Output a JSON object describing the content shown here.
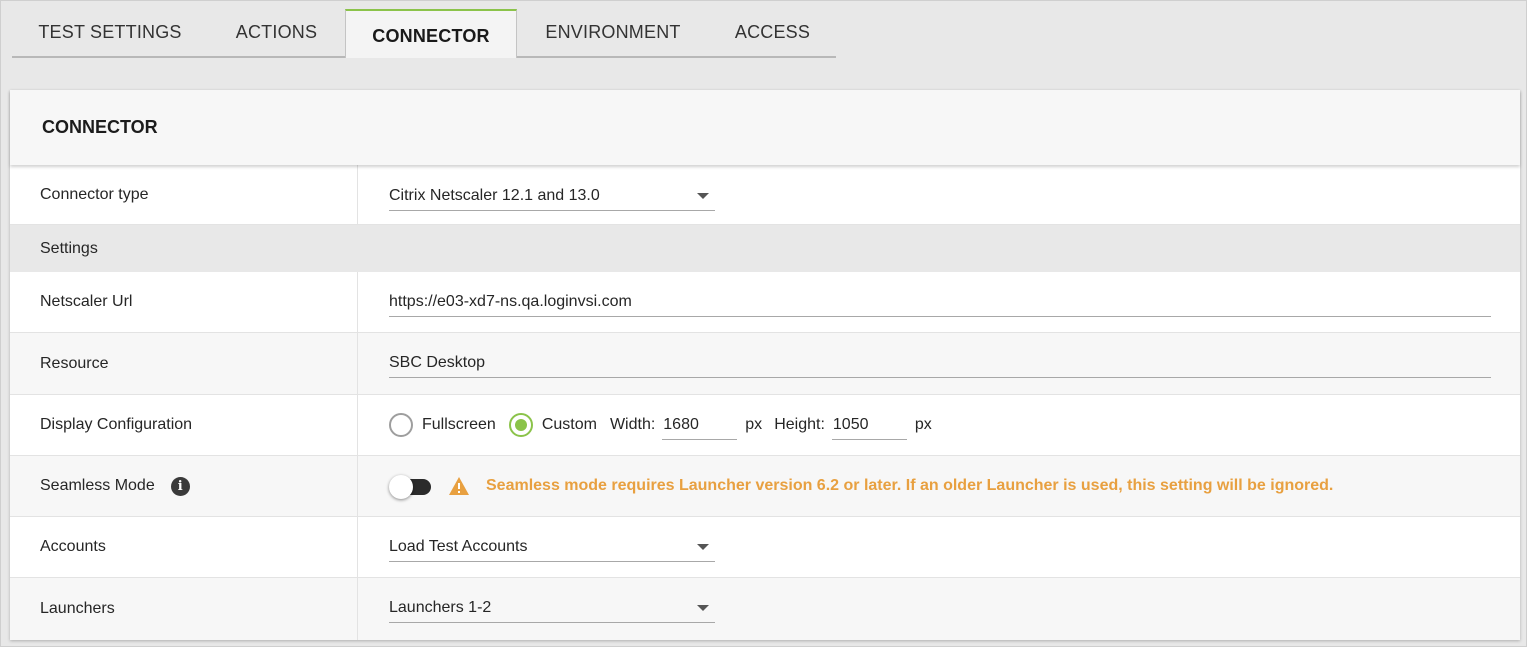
{
  "tabs": [
    {
      "label": "TEST SETTINGS",
      "active": false
    },
    {
      "label": "ACTIONS",
      "active": false
    },
    {
      "label": "CONNECTOR",
      "active": true
    },
    {
      "label": "ENVIRONMENT",
      "active": false
    },
    {
      "label": "ACCESS",
      "active": false
    }
  ],
  "card": {
    "title": "CONNECTOR",
    "connector_type": {
      "label": "Connector type",
      "value": "Citrix Netscaler 12.1 and 13.0"
    },
    "settings_section": "Settings",
    "netscaler_url": {
      "label": "Netscaler Url",
      "value": "https://e03-xd7-ns.qa.loginvsi.com"
    },
    "resource": {
      "label": "Resource",
      "value": "SBC Desktop"
    },
    "display": {
      "label": "Display Configuration",
      "fullscreen_label": "Fullscreen",
      "custom_label": "Custom",
      "selected": "Custom",
      "width_label": "Width:",
      "width_value": "1680",
      "height_label": "Height:",
      "height_value": "1050",
      "unit": "px"
    },
    "seamless": {
      "label": "Seamless Mode",
      "info_icon": "info-icon",
      "enabled": false,
      "warning_icon": "warning-icon",
      "warning_text": "Seamless mode requires Launcher version 6.2 or later. If an older Launcher is used, this setting will be ignored."
    },
    "accounts": {
      "label": "Accounts",
      "value": "Load Test Accounts"
    },
    "launchers": {
      "label": "Launchers",
      "value": "Launchers 1-2"
    }
  },
  "colors": {
    "accent": "#8bc34a",
    "warning": "#e8a040",
    "background": "#e8e8e8"
  }
}
